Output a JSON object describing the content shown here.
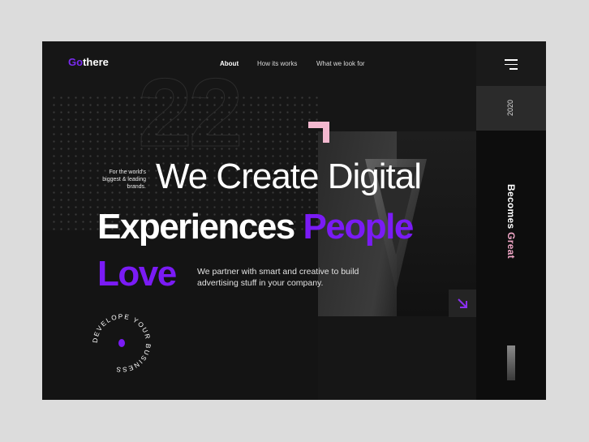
{
  "brand": {
    "prefix": "Go",
    "suffix": "there",
    "accent": "#7a1bf5"
  },
  "nav": {
    "items": [
      {
        "label": "About",
        "active": true
      },
      {
        "label": "How its works",
        "active": false
      },
      {
        "label": "What we look for",
        "active": false
      }
    ]
  },
  "side": {
    "year": "2020",
    "becomes": "Becomes",
    "great": "Great"
  },
  "hero": {
    "tagline": "For the world's biggest & leading brands.",
    "line1": "We Create Digital",
    "line2": "Experiences",
    "line2_accent": "People",
    "line3": "Love",
    "description": "We partner with smart and creative to build advertising stuff in your company.",
    "bignum": "22"
  },
  "badge": {
    "text": "DEVELOPE YOUR BUSINESS "
  },
  "colors": {
    "pink": "#f3b8cf",
    "purple": "#7a1bf5",
    "bg": "#161616"
  },
  "icons": [
    "hamburger-icon",
    "arrow-down-right-icon",
    "play-icon"
  ]
}
